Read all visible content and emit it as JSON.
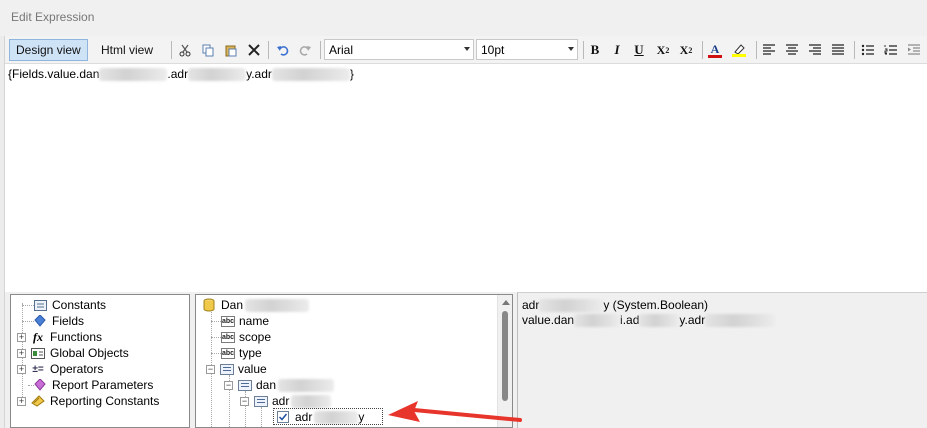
{
  "window": {
    "title": "Edit Expression"
  },
  "toolbar": {
    "design_view": "Design view",
    "html_view": "Html view",
    "font_name": "Arial",
    "font_size": "10pt"
  },
  "editor": {
    "expr_start": "{Fields.value.dan",
    "expr_mid1": ".adr",
    "expr_mid2": "y.adr",
    "expr_end": "}"
  },
  "categories": [
    {
      "label": "Constants",
      "icon": "constants-icon",
      "expandable": false
    },
    {
      "label": "Fields",
      "icon": "fields-icon",
      "expandable": false
    },
    {
      "label": "Functions",
      "icon": "function-icon",
      "expandable": true
    },
    {
      "label": "Global Objects",
      "icon": "global-objects-icon",
      "expandable": true
    },
    {
      "label": "Operators",
      "icon": "operators-icon",
      "expandable": true
    },
    {
      "label": "Report Parameters",
      "icon": "report-parameters-icon",
      "expandable": false
    },
    {
      "label": "Reporting Constants",
      "icon": "reporting-constants-icon",
      "expandable": true
    }
  ],
  "fields_tree": {
    "root": "Dan",
    "items": [
      "name",
      "scope",
      "type",
      "value"
    ],
    "sub1": "dan",
    "sub2": "adr",
    "selected": "adr",
    "selected_suffix": "y"
  },
  "info": {
    "line1_prefix": "adr",
    "line1_suffix": "y (System.Boolean)",
    "line2_a": "value.dan",
    "line2_b": "i.ad",
    "line2_c": "y.adr"
  },
  "colors": {
    "active_tab": "#cfe3f7",
    "arrow": "#e8352b",
    "font_color_bar": "#d01010",
    "highlight_bar": "#ffff00"
  }
}
